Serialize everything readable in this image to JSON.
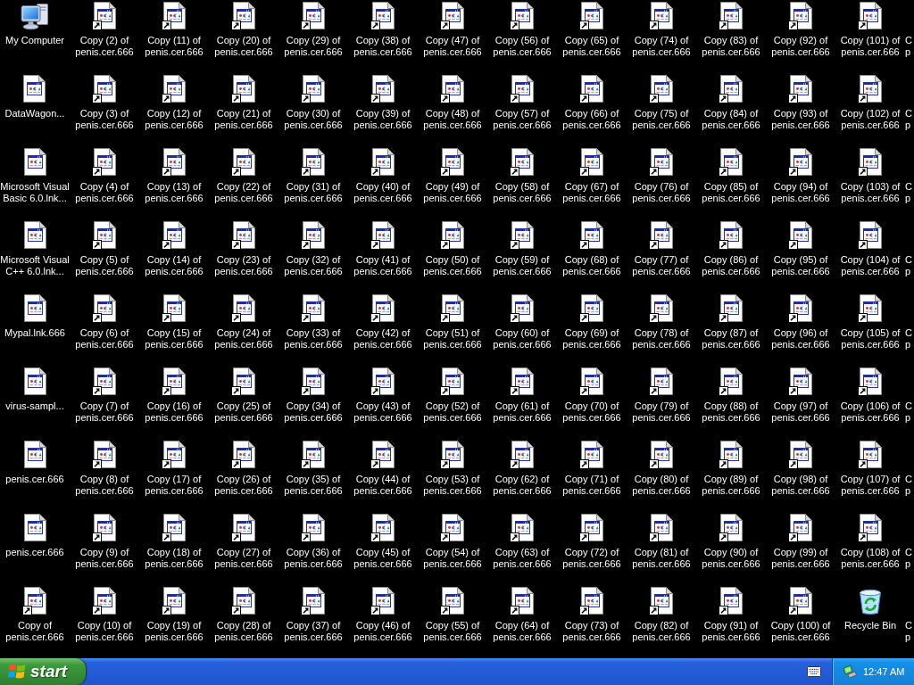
{
  "desktop": {
    "columns": [
      [
        {
          "kind": "computer",
          "shortcut": false,
          "label": [
            "My Computer"
          ]
        },
        {
          "kind": "document",
          "shortcut": false,
          "label": [
            "DataWagon..."
          ]
        },
        {
          "kind": "document",
          "shortcut": false,
          "label": [
            "Microsoft Visual",
            "Basic 6.0.lnk..."
          ]
        },
        {
          "kind": "document",
          "shortcut": false,
          "label": [
            "Microsoft Visual",
            "C++ 6.0.lnk..."
          ]
        },
        {
          "kind": "document",
          "shortcut": false,
          "label": [
            "Mypal.lnk.666"
          ]
        },
        {
          "kind": "document",
          "shortcut": false,
          "label": [
            "virus-sampl..."
          ]
        },
        {
          "kind": "document",
          "shortcut": false,
          "label": [
            "penis.cer.666"
          ]
        },
        {
          "kind": "document",
          "shortcut": false,
          "label": [
            "penis.cer.666"
          ]
        },
        {
          "kind": "document",
          "shortcut": true,
          "label": [
            "Copy of",
            "penis.cer.666"
          ]
        }
      ],
      [
        {
          "kind": "document",
          "shortcut": true,
          "label": [
            "Copy (2) of",
            "penis.cer.666"
          ]
        },
        {
          "kind": "document",
          "shortcut": true,
          "label": [
            "Copy (3) of",
            "penis.cer.666"
          ]
        },
        {
          "kind": "document",
          "shortcut": true,
          "label": [
            "Copy (4) of",
            "penis.cer.666"
          ]
        },
        {
          "kind": "document",
          "shortcut": true,
          "label": [
            "Copy (5) of",
            "penis.cer.666"
          ]
        },
        {
          "kind": "document",
          "shortcut": true,
          "label": [
            "Copy (6) of",
            "penis.cer.666"
          ]
        },
        {
          "kind": "document",
          "shortcut": true,
          "label": [
            "Copy (7) of",
            "penis.cer.666"
          ]
        },
        {
          "kind": "document",
          "shortcut": true,
          "label": [
            "Copy (8) of",
            "penis.cer.666"
          ]
        },
        {
          "kind": "document",
          "shortcut": true,
          "label": [
            "Copy (9) of",
            "penis.cer.666"
          ]
        },
        {
          "kind": "document",
          "shortcut": true,
          "label": [
            "Copy (10) of",
            "penis.cer.666"
          ]
        }
      ],
      [
        {
          "kind": "document",
          "shortcut": true,
          "label": [
            "Copy (11) of",
            "penis.cer.666"
          ]
        },
        {
          "kind": "document",
          "shortcut": true,
          "label": [
            "Copy (12) of",
            "penis.cer.666"
          ]
        },
        {
          "kind": "document",
          "shortcut": true,
          "label": [
            "Copy (13) of",
            "penis.cer.666"
          ]
        },
        {
          "kind": "document",
          "shortcut": true,
          "label": [
            "Copy (14) of",
            "penis.cer.666"
          ]
        },
        {
          "kind": "document",
          "shortcut": true,
          "label": [
            "Copy (15) of",
            "penis.cer.666"
          ]
        },
        {
          "kind": "document",
          "shortcut": true,
          "label": [
            "Copy (16) of",
            "penis.cer.666"
          ]
        },
        {
          "kind": "document",
          "shortcut": true,
          "label": [
            "Copy (17) of",
            "penis.cer.666"
          ]
        },
        {
          "kind": "document",
          "shortcut": true,
          "label": [
            "Copy (18) of",
            "penis.cer.666"
          ]
        },
        {
          "kind": "document",
          "shortcut": true,
          "label": [
            "Copy (19) of",
            "penis.cer.666"
          ]
        }
      ],
      [
        {
          "kind": "document",
          "shortcut": true,
          "label": [
            "Copy (20) of",
            "penis.cer.666"
          ]
        },
        {
          "kind": "document",
          "shortcut": true,
          "label": [
            "Copy (21) of",
            "penis.cer.666"
          ]
        },
        {
          "kind": "document",
          "shortcut": true,
          "label": [
            "Copy (22) of",
            "penis.cer.666"
          ]
        },
        {
          "kind": "document",
          "shortcut": true,
          "label": [
            "Copy (23) of",
            "penis.cer.666"
          ]
        },
        {
          "kind": "document",
          "shortcut": true,
          "label": [
            "Copy (24) of",
            "penis.cer.666"
          ]
        },
        {
          "kind": "document",
          "shortcut": true,
          "label": [
            "Copy (25) of",
            "penis.cer.666"
          ]
        },
        {
          "kind": "document",
          "shortcut": true,
          "label": [
            "Copy (26) of",
            "penis.cer.666"
          ]
        },
        {
          "kind": "document",
          "shortcut": true,
          "label": [
            "Copy (27) of",
            "penis.cer.666"
          ]
        },
        {
          "kind": "document",
          "shortcut": true,
          "label": [
            "Copy (28) of",
            "penis.cer.666"
          ]
        }
      ],
      [
        {
          "kind": "document",
          "shortcut": true,
          "label": [
            "Copy (29) of",
            "penis.cer.666"
          ]
        },
        {
          "kind": "document",
          "shortcut": true,
          "label": [
            "Copy (30) of",
            "penis.cer.666"
          ]
        },
        {
          "kind": "document",
          "shortcut": true,
          "label": [
            "Copy (31) of",
            "penis.cer.666"
          ]
        },
        {
          "kind": "document",
          "shortcut": true,
          "label": [
            "Copy (32) of",
            "penis.cer.666"
          ]
        },
        {
          "kind": "document",
          "shortcut": true,
          "label": [
            "Copy (33) of",
            "penis.cer.666"
          ]
        },
        {
          "kind": "document",
          "shortcut": true,
          "label": [
            "Copy (34) of",
            "penis.cer.666"
          ]
        },
        {
          "kind": "document",
          "shortcut": true,
          "label": [
            "Copy (35) of",
            "penis.cer.666"
          ]
        },
        {
          "kind": "document",
          "shortcut": true,
          "label": [
            "Copy (36) of",
            "penis.cer.666"
          ]
        },
        {
          "kind": "document",
          "shortcut": true,
          "label": [
            "Copy (37) of",
            "penis.cer.666"
          ]
        }
      ],
      [
        {
          "kind": "document",
          "shortcut": true,
          "label": [
            "Copy (38) of",
            "penis.cer.666"
          ]
        },
        {
          "kind": "document",
          "shortcut": true,
          "label": [
            "Copy (39) of",
            "penis.cer.666"
          ]
        },
        {
          "kind": "document",
          "shortcut": true,
          "label": [
            "Copy (40) of",
            "penis.cer.666"
          ]
        },
        {
          "kind": "document",
          "shortcut": true,
          "label": [
            "Copy (41) of",
            "penis.cer.666"
          ]
        },
        {
          "kind": "document",
          "shortcut": true,
          "label": [
            "Copy (42) of",
            "penis.cer.666"
          ]
        },
        {
          "kind": "document",
          "shortcut": true,
          "label": [
            "Copy (43) of",
            "penis.cer.666"
          ]
        },
        {
          "kind": "document",
          "shortcut": true,
          "label": [
            "Copy (44) of",
            "penis.cer.666"
          ]
        },
        {
          "kind": "document",
          "shortcut": true,
          "label": [
            "Copy (45) of",
            "penis.cer.666"
          ]
        },
        {
          "kind": "document",
          "shortcut": true,
          "label": [
            "Copy (46) of",
            "penis.cer.666"
          ]
        }
      ],
      [
        {
          "kind": "document",
          "shortcut": true,
          "label": [
            "Copy (47) of",
            "penis.cer.666"
          ]
        },
        {
          "kind": "document",
          "shortcut": true,
          "label": [
            "Copy (48) of",
            "penis.cer.666"
          ]
        },
        {
          "kind": "document",
          "shortcut": true,
          "label": [
            "Copy (49) of",
            "penis.cer.666"
          ]
        },
        {
          "kind": "document",
          "shortcut": true,
          "label": [
            "Copy (50) of",
            "penis.cer.666"
          ]
        },
        {
          "kind": "document",
          "shortcut": true,
          "label": [
            "Copy (51) of",
            "penis.cer.666"
          ]
        },
        {
          "kind": "document",
          "shortcut": true,
          "label": [
            "Copy (52) of",
            "penis.cer.666"
          ]
        },
        {
          "kind": "document",
          "shortcut": true,
          "label": [
            "Copy (53) of",
            "penis.cer.666"
          ]
        },
        {
          "kind": "document",
          "shortcut": true,
          "label": [
            "Copy (54) of",
            "penis.cer.666"
          ]
        },
        {
          "kind": "document",
          "shortcut": true,
          "label": [
            "Copy (55) of",
            "penis.cer.666"
          ]
        }
      ],
      [
        {
          "kind": "document",
          "shortcut": true,
          "label": [
            "Copy (56) of",
            "penis.cer.666"
          ]
        },
        {
          "kind": "document",
          "shortcut": true,
          "label": [
            "Copy (57) of",
            "penis.cer.666"
          ]
        },
        {
          "kind": "document",
          "shortcut": true,
          "label": [
            "Copy (58) of",
            "penis.cer.666"
          ]
        },
        {
          "kind": "document",
          "shortcut": true,
          "label": [
            "Copy (59) of",
            "penis.cer.666"
          ]
        },
        {
          "kind": "document",
          "shortcut": true,
          "label": [
            "Copy (60) of",
            "penis.cer.666"
          ]
        },
        {
          "kind": "document",
          "shortcut": true,
          "label": [
            "Copy (61) of",
            "penis.cer.666"
          ]
        },
        {
          "kind": "document",
          "shortcut": true,
          "label": [
            "Copy (62) of",
            "penis.cer.666"
          ]
        },
        {
          "kind": "document",
          "shortcut": true,
          "label": [
            "Copy (63) of",
            "penis.cer.666"
          ]
        },
        {
          "kind": "document",
          "shortcut": true,
          "label": [
            "Copy (64) of",
            "penis.cer.666"
          ]
        }
      ],
      [
        {
          "kind": "document",
          "shortcut": true,
          "label": [
            "Copy (65) of",
            "penis.cer.666"
          ]
        },
        {
          "kind": "document",
          "shortcut": true,
          "label": [
            "Copy (66) of",
            "penis.cer.666"
          ]
        },
        {
          "kind": "document",
          "shortcut": true,
          "label": [
            "Copy (67) of",
            "penis.cer.666"
          ]
        },
        {
          "kind": "document",
          "shortcut": true,
          "label": [
            "Copy (68) of",
            "penis.cer.666"
          ]
        },
        {
          "kind": "document",
          "shortcut": true,
          "label": [
            "Copy (69) of",
            "penis.cer.666"
          ]
        },
        {
          "kind": "document",
          "shortcut": true,
          "label": [
            "Copy (70) of",
            "penis.cer.666"
          ]
        },
        {
          "kind": "document",
          "shortcut": true,
          "label": [
            "Copy (71) of",
            "penis.cer.666"
          ]
        },
        {
          "kind": "document",
          "shortcut": true,
          "label": [
            "Copy (72) of",
            "penis.cer.666"
          ]
        },
        {
          "kind": "document",
          "shortcut": true,
          "label": [
            "Copy (73) of",
            "penis.cer.666"
          ]
        }
      ],
      [
        {
          "kind": "document",
          "shortcut": true,
          "label": [
            "Copy (74) of",
            "penis.cer.666"
          ]
        },
        {
          "kind": "document",
          "shortcut": true,
          "label": [
            "Copy (75) of",
            "penis.cer.666"
          ]
        },
        {
          "kind": "document",
          "shortcut": true,
          "label": [
            "Copy (76) of",
            "penis.cer.666"
          ]
        },
        {
          "kind": "document",
          "shortcut": true,
          "label": [
            "Copy (77) of",
            "penis.cer.666"
          ]
        },
        {
          "kind": "document",
          "shortcut": true,
          "label": [
            "Copy (78) of",
            "penis.cer.666"
          ]
        },
        {
          "kind": "document",
          "shortcut": true,
          "label": [
            "Copy (79) of",
            "penis.cer.666"
          ]
        },
        {
          "kind": "document",
          "shortcut": true,
          "label": [
            "Copy (80) of",
            "penis.cer.666"
          ]
        },
        {
          "kind": "document",
          "shortcut": true,
          "label": [
            "Copy (81) of",
            "penis.cer.666"
          ]
        },
        {
          "kind": "document",
          "shortcut": true,
          "label": [
            "Copy (82) of",
            "penis.cer.666"
          ]
        }
      ],
      [
        {
          "kind": "document",
          "shortcut": true,
          "label": [
            "Copy (83) of",
            "penis.cer.666"
          ]
        },
        {
          "kind": "document",
          "shortcut": true,
          "label": [
            "Copy (84) of",
            "penis.cer.666"
          ]
        },
        {
          "kind": "document",
          "shortcut": true,
          "label": [
            "Copy (85) of",
            "penis.cer.666"
          ]
        },
        {
          "kind": "document",
          "shortcut": true,
          "label": [
            "Copy (86) of",
            "penis.cer.666"
          ]
        },
        {
          "kind": "document",
          "shortcut": true,
          "label": [
            "Copy (87) of",
            "penis.cer.666"
          ]
        },
        {
          "kind": "document",
          "shortcut": true,
          "label": [
            "Copy (88) of",
            "penis.cer.666"
          ]
        },
        {
          "kind": "document",
          "shortcut": true,
          "label": [
            "Copy (89) of",
            "penis.cer.666"
          ]
        },
        {
          "kind": "document",
          "shortcut": true,
          "label": [
            "Copy (90) of",
            "penis.cer.666"
          ]
        },
        {
          "kind": "document",
          "shortcut": true,
          "label": [
            "Copy (91) of",
            "penis.cer.666"
          ]
        }
      ],
      [
        {
          "kind": "document",
          "shortcut": true,
          "label": [
            "Copy (92) of",
            "penis.cer.666"
          ]
        },
        {
          "kind": "document",
          "shortcut": true,
          "label": [
            "Copy (93) of",
            "penis.cer.666"
          ]
        },
        {
          "kind": "document",
          "shortcut": true,
          "label": [
            "Copy (94) of",
            "penis.cer.666"
          ]
        },
        {
          "kind": "document",
          "shortcut": true,
          "label": [
            "Copy (95) of",
            "penis.cer.666"
          ]
        },
        {
          "kind": "document",
          "shortcut": true,
          "label": [
            "Copy (96) of",
            "penis.cer.666"
          ]
        },
        {
          "kind": "document",
          "shortcut": true,
          "label": [
            "Copy (97) of",
            "penis.cer.666"
          ]
        },
        {
          "kind": "document",
          "shortcut": true,
          "label": [
            "Copy (98) of",
            "penis.cer.666"
          ]
        },
        {
          "kind": "document",
          "shortcut": true,
          "label": [
            "Copy (99) of",
            "penis.cer.666"
          ]
        },
        {
          "kind": "document",
          "shortcut": true,
          "label": [
            "Copy (100) of",
            "penis.cer.666"
          ]
        }
      ],
      [
        {
          "kind": "document",
          "shortcut": true,
          "label": [
            "Copy (101) of",
            "penis.cer.666"
          ]
        },
        {
          "kind": "document",
          "shortcut": true,
          "label": [
            "Copy (102) of",
            "penis.cer.666"
          ]
        },
        {
          "kind": "document",
          "shortcut": true,
          "label": [
            "Copy (103) of",
            "penis.cer.666"
          ]
        },
        {
          "kind": "document",
          "shortcut": true,
          "label": [
            "Copy (104) of",
            "penis.cer.666"
          ]
        },
        {
          "kind": "document",
          "shortcut": true,
          "label": [
            "Copy (105) of",
            "penis.cer.666"
          ]
        },
        {
          "kind": "document",
          "shortcut": true,
          "label": [
            "Copy (106) of",
            "penis.cer.666"
          ]
        },
        {
          "kind": "document",
          "shortcut": true,
          "label": [
            "Copy (107) of",
            "penis.cer.666"
          ]
        },
        {
          "kind": "document",
          "shortcut": true,
          "label": [
            "Copy (108) of",
            "penis.cer.666"
          ]
        },
        {
          "kind": "recycle_bin",
          "shortcut": false,
          "label": [
            "Recycle Bin"
          ]
        }
      ],
      [
        {
          "kind": "cut_off",
          "label": [
            "C",
            "p"
          ]
        },
        {
          "kind": "cut_off",
          "label": [
            "C",
            "p"
          ]
        },
        {
          "kind": "cut_off",
          "label": [
            "C",
            "p"
          ]
        },
        {
          "kind": "cut_off",
          "label": [
            "C",
            "p"
          ]
        },
        {
          "kind": "cut_off",
          "label": [
            "C",
            "p"
          ]
        },
        {
          "kind": "cut_off",
          "label": [
            "C",
            "p"
          ]
        },
        {
          "kind": "cut_off",
          "label": [
            "C",
            "p"
          ]
        },
        {
          "kind": "cut_off",
          "label": [
            "C",
            "p"
          ]
        },
        {
          "kind": "cut_off",
          "label": [
            "C",
            "p"
          ]
        }
      ]
    ]
  },
  "taskbar": {
    "start_button": {
      "label": "start"
    },
    "tray": {
      "clock": "12:47 AM"
    }
  }
}
